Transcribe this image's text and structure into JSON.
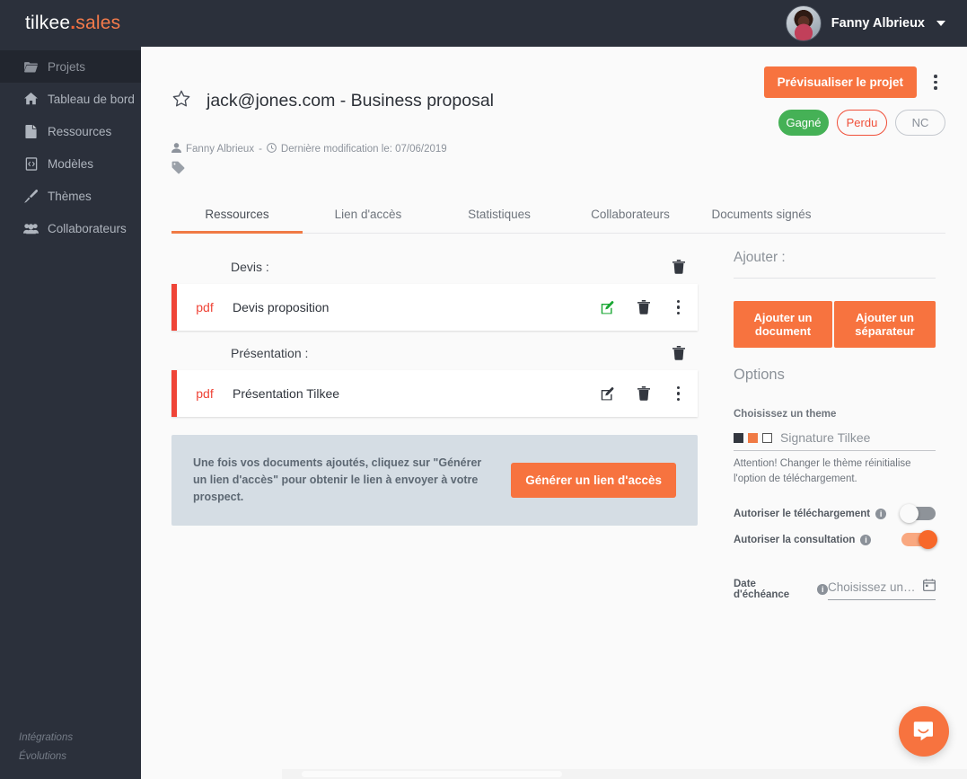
{
  "topbar": {
    "logo_part1": "tilkee",
    "logo_dot": ".",
    "logo_part2": "sales",
    "user_name": "Fanny Albrieux"
  },
  "sidebar": {
    "items": [
      {
        "label": "Projets",
        "icon": "folder-icon",
        "active": true
      },
      {
        "label": "Tableau de bord",
        "icon": "home-icon",
        "active": false
      },
      {
        "label": "Ressources",
        "icon": "file-icon",
        "active": false
      },
      {
        "label": "Modèles",
        "icon": "code-file-icon",
        "active": false
      },
      {
        "label": "Thèmes",
        "icon": "brush-icon",
        "active": false
      },
      {
        "label": "Collaborateurs",
        "icon": "users-icon",
        "active": false
      }
    ],
    "footer": [
      {
        "label": "Intégrations"
      },
      {
        "label": "Évolutions"
      }
    ]
  },
  "header": {
    "title": "jack@jones.com - Business proposal",
    "preview_button": "Prévisualiser le projet",
    "author": "Fanny Albrieux",
    "separator": " - ",
    "last_modified": "Dernière modification le: 07/06/2019",
    "status": {
      "won": "Gagné",
      "lost": "Perdu",
      "nc": "NC"
    }
  },
  "tabs": [
    {
      "label": "Ressources",
      "active": true
    },
    {
      "label": "Lien d'accès",
      "active": false
    },
    {
      "label": "Statistiques",
      "active": false
    },
    {
      "label": "Collaborateurs",
      "active": false
    },
    {
      "label": "Documents signés",
      "active": false
    }
  ],
  "resources": {
    "groups": [
      {
        "separator_label": "Devis :",
        "doc_type": "pdf",
        "doc_name": "Devis proposition",
        "edit_color": "#1aa734"
      },
      {
        "separator_label": "Présentation :",
        "doc_type": "pdf",
        "doc_name": "Présentation Tilkee",
        "edit_color": "#33373f"
      }
    ],
    "info_text": "Une fois vos documents ajoutés, cliquez sur \"Générer un lien d'accès\" pour obtenir le lien à envoyer à votre prospect.",
    "generate_button": "Générer un lien d'accès"
  },
  "panel": {
    "add_title": "Ajouter :",
    "add_document_button": "Ajouter un document",
    "add_separator_button": "Ajouter un séparateur",
    "options_title": "Options",
    "theme_label": "Choisissez un theme",
    "theme_name": "Signature Tilkee",
    "theme_swatches": [
      "#33373f",
      "#f07a45",
      "#ffffff"
    ],
    "theme_note": "Attention! Changer le thème réinitialise l'option de téléchargement.",
    "download_toggle_label": "Autoriser le téléchargement",
    "download_toggle_state": "off",
    "consult_toggle_label": "Autoriser la consultation",
    "consult_toggle_state": "on",
    "date_label": "Date d'échéance",
    "date_placeholder": "Choisissez un…"
  },
  "colors": {
    "accent": "#f7733f",
    "sidebar": "#2b303b",
    "pdf_red": "#ef4437",
    "won_green": "#45b156",
    "lost_red": "#f0503a"
  }
}
